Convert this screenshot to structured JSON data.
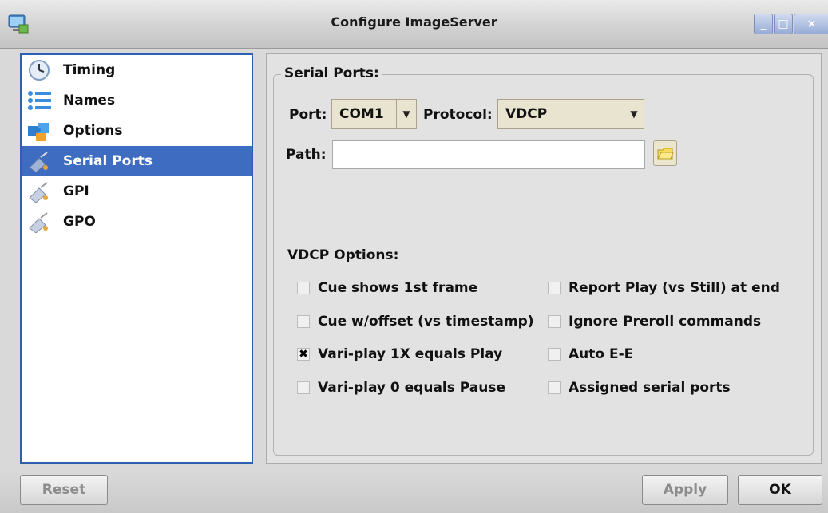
{
  "window": {
    "title": "Configure ImageServer",
    "controls": {
      "minimize": "_",
      "maximize": "□",
      "close": "×"
    }
  },
  "sidebar": {
    "items": [
      {
        "label": "Timing",
        "icon": "clock-icon",
        "selected": false
      },
      {
        "label": "Names",
        "icon": "list-icon",
        "selected": false
      },
      {
        "label": "Options",
        "icon": "puzzle-icon",
        "selected": false
      },
      {
        "label": "Serial Ports",
        "icon": "plug-icon",
        "selected": true
      },
      {
        "label": "GPI",
        "icon": "plug-icon",
        "selected": false
      },
      {
        "label": "GPO",
        "icon": "plug-icon",
        "selected": false
      }
    ]
  },
  "serial_ports": {
    "group_title": "Serial Ports:",
    "port_label": "Port:",
    "port_value": "COM1",
    "protocol_label": "Protocol:",
    "protocol_value": "VDCP",
    "path_label": "Path:",
    "path_value": ""
  },
  "vdcp_options": {
    "title": "VDCP Options:",
    "left": [
      {
        "label": "Cue shows 1st frame",
        "checked": false
      },
      {
        "label": "Cue w/offset (vs timestamp)",
        "checked": false
      },
      {
        "label": "Vari-play 1X equals Play",
        "checked": true
      },
      {
        "label": "Vari-play 0 equals Pause",
        "checked": false
      }
    ],
    "right": [
      {
        "label": "Report Play (vs Still) at end",
        "checked": false
      },
      {
        "label": "Ignore Preroll commands",
        "checked": false
      },
      {
        "label": "Auto E-E",
        "checked": false
      },
      {
        "label": "Assigned serial ports",
        "checked": false
      }
    ]
  },
  "buttons": {
    "reset": {
      "mnemonic": "R",
      "rest": "eset",
      "enabled": false
    },
    "apply": {
      "mnemonic": "A",
      "rest": "pply",
      "enabled": false
    },
    "ok": {
      "mnemonic": "O",
      "rest": "K",
      "enabled": true
    }
  },
  "colors": {
    "selection": "#3d6cc0",
    "list_border": "#2f5fb0",
    "combo_bg": "#e9e4cf"
  }
}
